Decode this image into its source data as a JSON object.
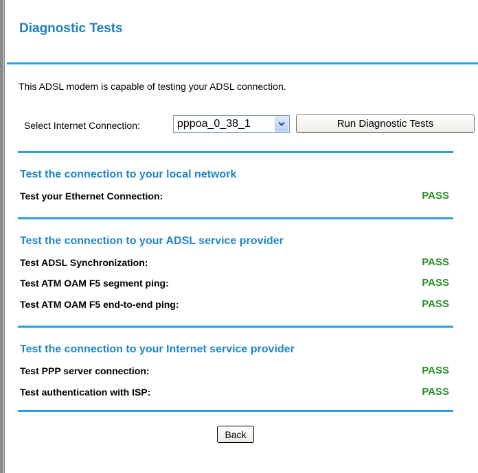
{
  "page": {
    "title": "Diagnostic Tests",
    "intro": "This ADSL modem is capable of testing your ADSL connection."
  },
  "connection": {
    "label": "Select Internet Connection:",
    "selected": "pppoa_0_38_1"
  },
  "buttons": {
    "run": "Run Diagnostic Tests",
    "back": "Back"
  },
  "sections": [
    {
      "heading": "Test the connection to your local network",
      "tests": [
        {
          "label": "Test your Ethernet Connection:",
          "result": "PASS"
        }
      ]
    },
    {
      "heading": "Test the connection to your ADSL service provider",
      "tests": [
        {
          "label": "Test ADSL Synchronization:",
          "result": "PASS"
        },
        {
          "label": "Test ATM OAM F5 segment ping:",
          "result": "PASS"
        },
        {
          "label": "Test ATM OAM F5 end-to-end ping:",
          "result": "PASS"
        }
      ]
    },
    {
      "heading": "Test the connection to your Internet service provider",
      "tests": [
        {
          "label": "Test PPP server connection:",
          "result": "PASS"
        },
        {
          "label": "Test authentication with ISP:",
          "result": "PASS"
        }
      ]
    }
  ],
  "colors": {
    "title": "#1f80c0",
    "heading": "#1f86c8",
    "divider": "#2a9fd6",
    "pass": "#2a8f2a"
  },
  "icons": {
    "select_arrow": "chevron-down-icon"
  }
}
